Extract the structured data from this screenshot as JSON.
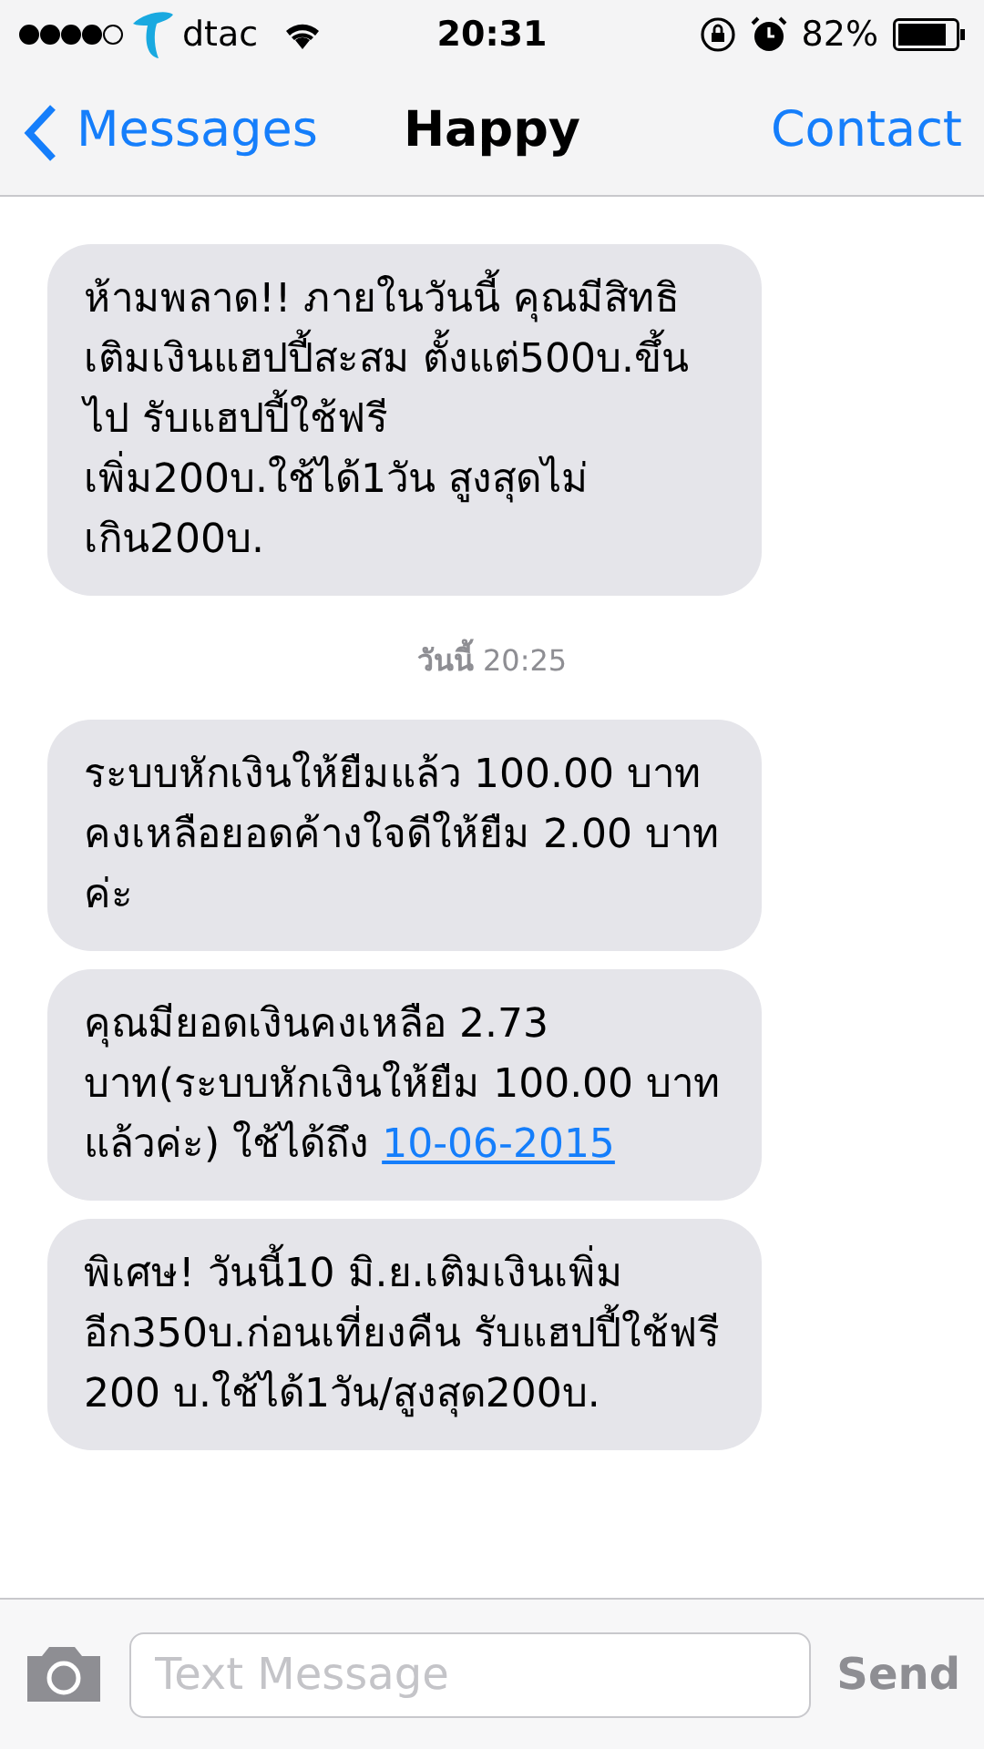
{
  "status_bar": {
    "carrier": "dtac",
    "time": "20:31",
    "battery": "82%"
  },
  "nav": {
    "back": "Messages",
    "title": "Happy",
    "action": "Contact"
  },
  "thread": [
    {
      "kind": "message",
      "text": "ห้ามพลาด!! ภายในวันนี้ คุณมีสิทธิเติมเงินแฮปปี้สะสม ตั้งแต่500บ.ขึ้นไป รับแฮปปี้ใช้ฟรี เพิ่ม200บ.ใช้ได้1วัน สูงสุดไม่เกิน200บ."
    },
    {
      "kind": "date",
      "day": "วันนี้",
      "time": "20:25"
    },
    {
      "kind": "message",
      "text": "ระบบหักเงินให้ยืมแล้ว 100.00 บาท คงเหลือยอดค้างใจดีให้ยืม 2.00 บาท ค่ะ"
    },
    {
      "kind": "message",
      "text": "คุณมียอดเงินคงเหลือ 2.73 บาท(ระบบหักเงินให้ยืม 100.00 บาท แล้วค่ะ) ใช้ได้ถึง",
      "link": "10-06-2015"
    },
    {
      "kind": "message",
      "text": "พิเศษ! วันนี้10 มิ.ย.เติมเงินเพิ่มอีก350บ.ก่อนเที่ยงคืน รับแฮปปี้ใช้ฟรี 200 บ.ใช้ได้1วัน/สูงสุด200บ."
    }
  ],
  "composer": {
    "placeholder": "Text Message",
    "send": "Send"
  }
}
